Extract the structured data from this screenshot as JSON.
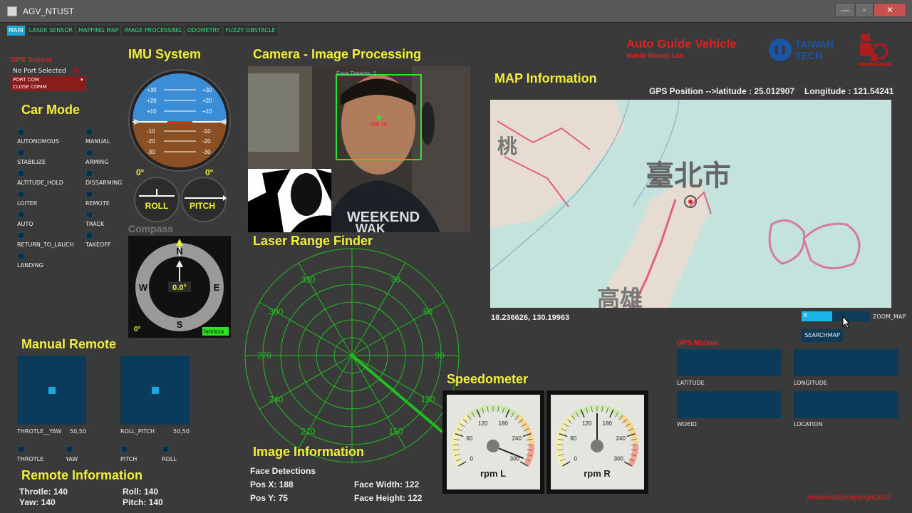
{
  "window": {
    "title": "AGV_NTUST",
    "min": "—",
    "max": "▫",
    "close": "✕"
  },
  "tabs": [
    "MAIN",
    "LASER SENSOR",
    "MAPPING MAP",
    "IMAGE PROCESSING",
    "ODOMETRY",
    "FUZZY OBSTACLE"
  ],
  "gps_sensor": {
    "title": "GPS Sensor",
    "status": "No Port Selected",
    "port": "PORT COM",
    "close": "CLOSE COMM"
  },
  "imu": {
    "title": "IMU System",
    "pitch_marks": [
      "+30",
      "+20",
      "+10",
      "-10",
      "-20",
      "-30"
    ],
    "roll_deg": "0°",
    "pitch_deg": "0°",
    "roll_label": "ROLL",
    "pitch_label": "PITCH"
  },
  "compass": {
    "title": "Compass",
    "heading": "0.0°",
    "n": "N",
    "s": "S",
    "e": "E",
    "w": "W",
    "deg": "0°",
    "user": "fahmiza"
  },
  "car_mode": {
    "title": "Car Mode",
    "left": [
      "AUTONOMOUS",
      "STABILIZE",
      "ALTITUDE_HOLD",
      "LOITER",
      "AUTO",
      "RETURN_TO_LAUCH",
      "LANDING"
    ],
    "right": [
      "MANUAL",
      "ARMING",
      "DISSARMING",
      "REMOTE",
      "TRACK",
      "TAKEOFF"
    ]
  },
  "manual_remote": {
    "title": "Manual Remote",
    "pad1_label": "THROTLE__YAW",
    "pad1_val": "50,50",
    "pad2_label": "ROLL_PITCH",
    "pad2_val": "50,50",
    "toggles": [
      "THROTLE",
      "YAW",
      "PITCH",
      "ROLL"
    ]
  },
  "remote_info": {
    "title": "Remote Information",
    "throttle": "Throtle: 140",
    "yaw": "Yaw: 140",
    "roll": "Roll: 140",
    "pitch": "Pitch: 140"
  },
  "camera": {
    "title": "Camera - Image Processing",
    "overlay": "Face Detects: 1",
    "coords": "188  75",
    "shirt_text": "WEEKEND",
    "shirt_text2": "WAK"
  },
  "laser": {
    "title": "Laser Range Finder",
    "angles": [
      "330",
      "30",
      "300",
      "60",
      "270",
      "90",
      "240",
      "120",
      "210",
      "150"
    ]
  },
  "image_info": {
    "title": "Image Information",
    "detections": "Face Detections",
    "pos_x": "Pos X: 188",
    "pos_y": "Pos Y: 75",
    "width": "Face Width: 122",
    "height": "Face Height: 122"
  },
  "header": {
    "app_title": "Auto Guide Vehicle",
    "lab": "Mobile Robots Lab",
    "taiwan": "TAIWAN",
    "tech": "TECH"
  },
  "map": {
    "title": "MAP Information",
    "gps_label": "GPS Position -->",
    "latitude": "latitude : 25.012907",
    "longitude": "Longitude : 121.54241",
    "city": "臺北市",
    "city2": "桃",
    "city3": "高雄",
    "coords": "18.236626, 130.19963",
    "zoom_value": "8",
    "zoom_label": "ZOOM_MAP",
    "zoom_fraction": 0.45,
    "search": "SEARCHMAP"
  },
  "gps_manual": {
    "title": "GPS Manual",
    "latitude": "LATITUDE",
    "longitude": "LONGITUDE",
    "woeid": "WOEID",
    "location": "LOCATION"
  },
  "speedometer": {
    "title": "Speedometer",
    "ticks": [
      "0",
      "60",
      "120",
      "180",
      "240",
      "300"
    ],
    "left_label": "rpm L",
    "right_label": "rpm R",
    "left_value": 290,
    "right_value": 150
  },
  "footer": "mohamad@copyright2016",
  "colors": {
    "heading": "#f2ee3a",
    "accent_red": "#e02020",
    "laser_green": "#1fbf1f",
    "panel_blue": "#0a3b5a"
  }
}
